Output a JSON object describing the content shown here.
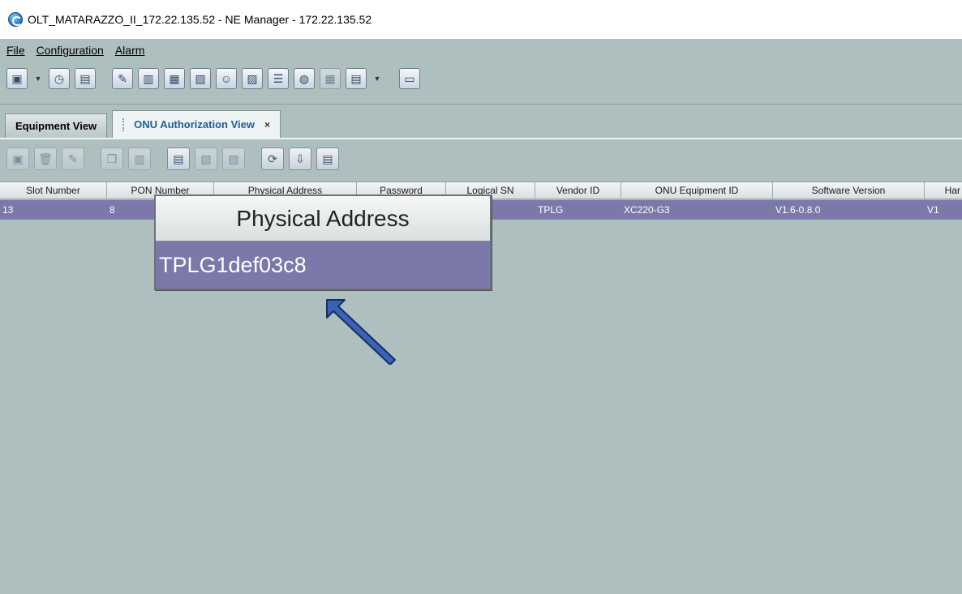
{
  "window": {
    "title": "OLT_MATARAZZO_II_172.22.135.52 - NE Manager - 172.22.135.52"
  },
  "menu": {
    "file": "File",
    "configuration": "Configuration",
    "alarm": "Alarm"
  },
  "tabs": {
    "equipment": "Equipment View",
    "onu": "ONU Authorization View",
    "close": "×"
  },
  "table": {
    "headers": [
      "Slot Number",
      "PON Number",
      "Physical Address",
      "Password",
      "Logical SN",
      "Vendor ID",
      "ONU Equipment ID",
      "Software Version",
      "Har"
    ],
    "row": [
      "13",
      "8",
      "",
      "",
      "",
      "TPLG",
      "XC220-G3",
      "V1.6-0.8.0",
      "V1"
    ]
  },
  "zoom": {
    "header": "Physical Address",
    "value": "TPLG1def03c8"
  },
  "colors": {
    "background": "#aebfbf",
    "selected_row": "#7c78a9",
    "arrow": "#3a62b8"
  }
}
